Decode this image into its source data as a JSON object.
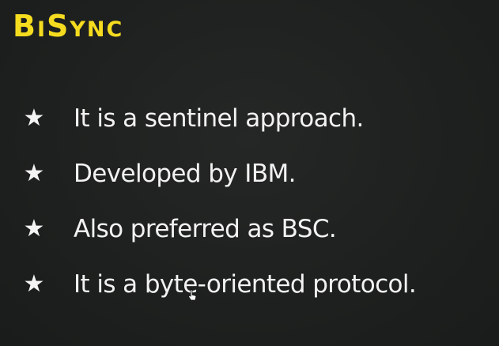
{
  "slide": {
    "title": "BiSync",
    "accent_color": "#f5dc1f",
    "bullet_icon": "star-icon",
    "bullets": [
      {
        "text": "It is a sentinel approach."
      },
      {
        "text": "Developed by IBM."
      },
      {
        "text": "Also preferred as BSC."
      },
      {
        "text": "It is a byte-oriented protocol."
      }
    ]
  },
  "cursor": {
    "icon": "hand-pointer-icon"
  }
}
